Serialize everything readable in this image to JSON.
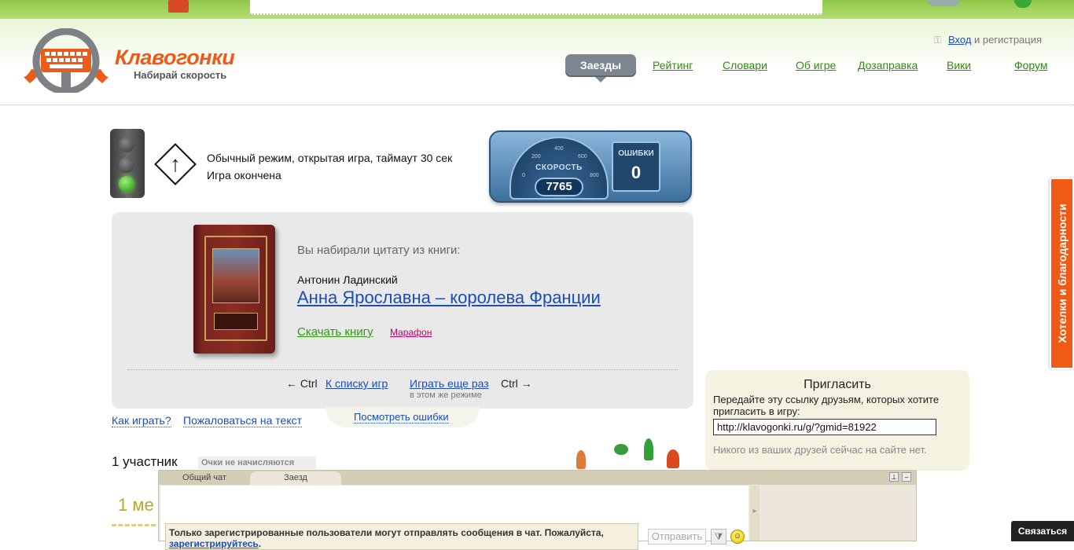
{
  "header": {
    "logo_title": "Клавогонки",
    "logo_subtitle": "Набирай скорость",
    "login_link": "Вход",
    "login_rest": " и регистрация",
    "nav": [
      {
        "label": "Заезды",
        "active": true
      },
      {
        "label": "Рейтинг"
      },
      {
        "label": "Словари"
      },
      {
        "label": "Об игре"
      },
      {
        "label": "Дозаправка"
      },
      {
        "label": "Вики"
      },
      {
        "label": "Форум"
      }
    ]
  },
  "game": {
    "mode_text": "Обычный режим, открытая игра, таймаут 30 сек",
    "status_text": "Игра окончена",
    "speed_label": "СКОРОСТЬ",
    "speed_value": "7765",
    "speed_ticks": [
      "0",
      "200",
      "400",
      "600",
      "800"
    ],
    "errors_label": "ОШИБКИ",
    "errors_value": "0"
  },
  "result": {
    "source_label": "Вы набирали цитату из книги:",
    "author": "Антонин Ладинский",
    "book_title": "Анна Ярославна – королева Франции",
    "download": "Скачать книгу",
    "marathon": "Марафон",
    "ctrl_left": "← Ctrl",
    "back_to_list": "К списку игр",
    "play_again": "Играть еще раз",
    "play_again_sub": "в этом же режиме",
    "ctrl_right": "Ctrl →"
  },
  "links": {
    "how_to_play": "Как играть?",
    "complain": "Пожаловаться на текст",
    "view_errors": "Посмотреть ошибки"
  },
  "participants": {
    "count_text": "1 участник",
    "points_badge": "Очки не начисляются",
    "place_text": "1 ме"
  },
  "invite": {
    "title": "Пригласить",
    "description": "Передайте эту ссылку друзьям, которых хотите пригласить в игру:",
    "link_value": "http://klavogonki.ru/g/?gmid=81922",
    "no_friends": "Никого из ваших друзей сейчас на сайте нет."
  },
  "side_tab": "Хотелки и благодарности",
  "chat": {
    "tabs": [
      "Общий чат",
      "Заезд"
    ],
    "notice": "Только зарегистрированные пользователи могут отправлять сообщения в чат. Пожалуйста,",
    "register_link": "зарегистрируйтесь",
    "notice_end": ".",
    "send_label": "Отправить"
  },
  "contact_button": "Связаться",
  "colors": {
    "brand_orange": "#f05a17",
    "nav_green": "#2f8d10",
    "link_blue": "#1a4dba"
  }
}
